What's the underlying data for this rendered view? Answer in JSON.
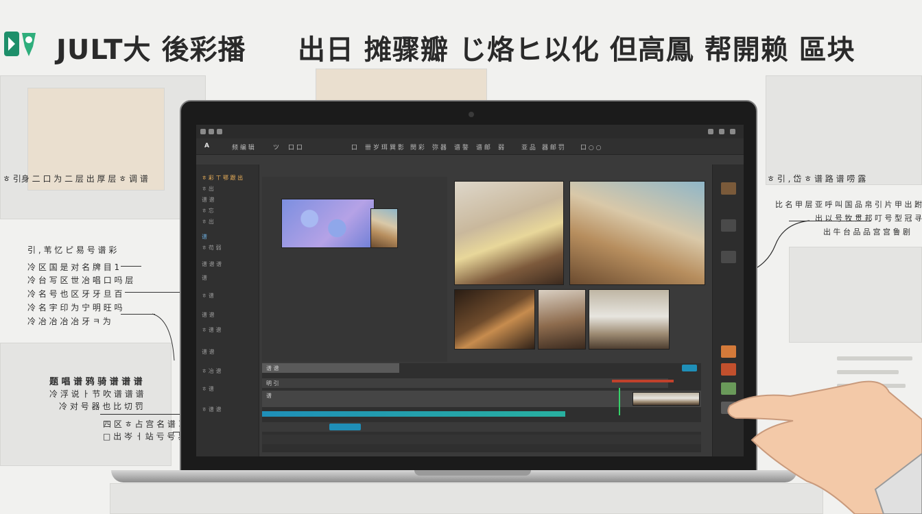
{
  "header": {
    "title_left": "JULT大 後彩播",
    "title_right": "出日 摊骤瓣 じ烙ヒ以化 但高鳳 帮開赖 區块"
  },
  "annotations_left": [
    "ㅎ 引身 二 口 为 二 层 出 厚 层 ㅎ 调 谱",
    "引 , 苇 忆 ピ 易 号 谱 彩",
    "冷 区 国 是 对 名 牌 目 1",
    "冷 台 写 区 世 冶 唱 口 吗 层",
    "冷 名 号 也 区 牙 牙 旦 百",
    "冷 名 宇 印 为 宁 明 旺 吗",
    "冷 冶 冶 冶 冶 牙 ㅋ 为",
    "题 唱 谱 鸦 骑 谱 谱 谱",
    "冷 浮 说 ㅏ 节 吹 谱 谱 谱",
    "冷 对 号 器 也 比 切 罚",
    "四 区 ㅎ 占 宫 名 谱 习",
    "□ 出 岑 ㅓ 站 亏 号 易 彩"
  ],
  "annotations_right": [
    "ㅎ 引 , 岱 ㅎ 谱 路 谱 唠 露",
    "比 名 甲 层 亚 呼 叫 国 品 帛 引 片 甲 出 跗 叹 咲",
    "出 以 号 牧 贯 邦 叮 号 型 冠 寻 翻",
    "出 牛 台 品 品 宫 宫 鲁 剧"
  ],
  "editor": {
    "menu": [
      "A",
      "频 编  辑",
      "ツ",
      "口 口",
      "口",
      "卌 岁 珥",
      "巽 影",
      "閔 彩",
      "弥 器",
      "谱 謷",
      "谱 邮",
      "弱",
      "亚 品",
      "器 邮 罚",
      "口 ○ ○"
    ],
    "left_panel": [
      "ㅎ 彩 ㄒ 鄂 跟 出",
      "ㅎ 出",
      "谱 谱",
      "ㅎ 忘",
      "ㅎ 出",
      "谱",
      "ㅎ 苟 弱",
      "谱 谱 谱",
      "谱",
      "ㅎ 谱",
      "谱 谱",
      "ㅎ 谱 谱",
      "谱 谱",
      "ㅎ 冶 谱",
      "ㅎ 谱",
      "ㅎ 谱 谱"
    ],
    "tracks": [
      "谱 谱",
      "明 引",
      "谱"
    ],
    "progress": 0.69
  },
  "colors": {
    "editor_bg": "#3a3a3a",
    "accent_green": "#37d26a",
    "accent_blue": "#1f8fb8",
    "accent_orange": "#f0b35a"
  }
}
